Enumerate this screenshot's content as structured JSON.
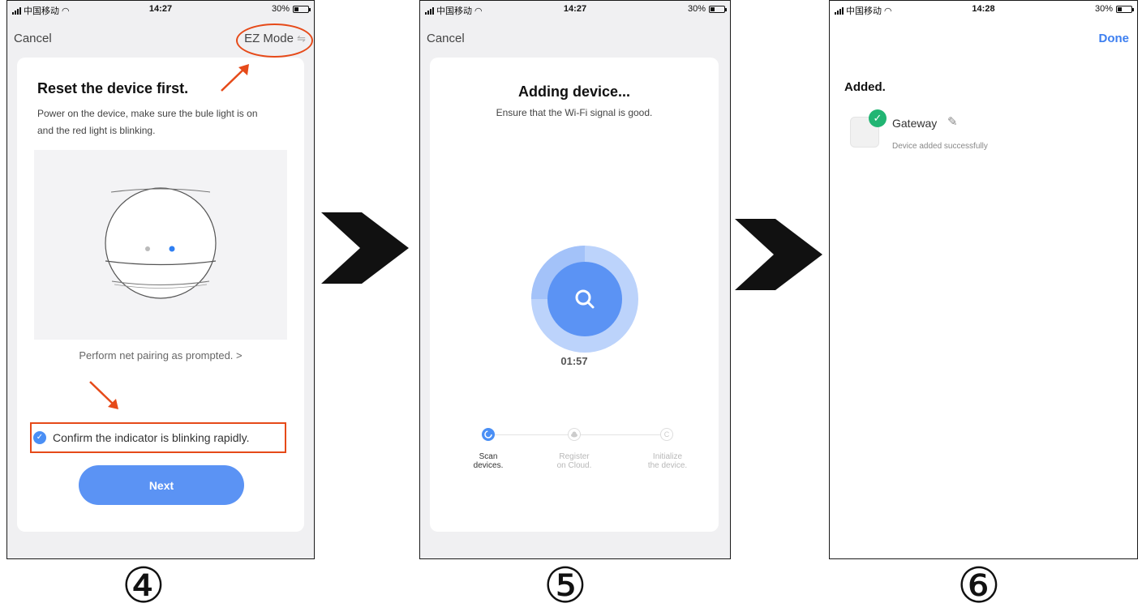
{
  "steps": [
    {
      "number": "④"
    },
    {
      "number": "⑤"
    },
    {
      "number": "⑥"
    }
  ],
  "screen4": {
    "status": {
      "carrier": "中国移动",
      "time": "14:27",
      "battery": "30%"
    },
    "nav": {
      "cancel": "Cancel",
      "mode": "EZ Mode",
      "mode_icon": "⇋"
    },
    "title": "Reset the device first.",
    "description_line1": "Power on the device, make sure the bule light is on",
    "description_line2": "and the red light is blinking.",
    "help_link": "Perform net pairing as prompted. >",
    "confirm_text": "Confirm the indicator is blinking rapidly.",
    "next_label": "Next"
  },
  "screen5": {
    "status": {
      "carrier": "中国移动",
      "time": "14:27",
      "battery": "30%"
    },
    "nav": {
      "cancel": "Cancel"
    },
    "title": "Adding device...",
    "subtitle": "Ensure that the Wi-Fi signal is good.",
    "timer": "01:57",
    "progress_steps": [
      {
        "line1": "Scan",
        "line2": "devices.",
        "state": "active"
      },
      {
        "line1": "Register",
        "line2": "on Cloud.",
        "state": "pending"
      },
      {
        "line1": "Initialize",
        "line2": "the device.",
        "state": "pending"
      }
    ]
  },
  "screen6": {
    "status": {
      "carrier": "中国移动",
      "time": "14:28",
      "battery": "30%"
    },
    "nav": {
      "done": "Done"
    },
    "added_title": "Added.",
    "device_name": "Gateway",
    "device_status": "Device added successfully"
  },
  "colors": {
    "accent_blue": "#5b93f4",
    "annotation_red": "#e64a19",
    "success_green": "#21b573",
    "arrow_black": "#111111"
  },
  "icons": [
    "signal-icon",
    "wifi-icon",
    "battery-icon",
    "swap-icon",
    "check-icon",
    "search-icon",
    "edit-icon",
    "arrow-right-icon"
  ]
}
